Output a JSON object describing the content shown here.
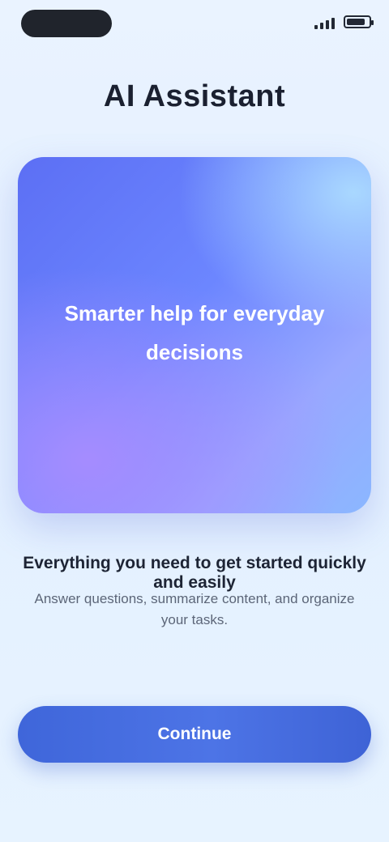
{
  "status_bar": {
    "left_pill": "",
    "icons": [
      "signal-icon",
      "battery-icon"
    ]
  },
  "title": "AI Assistant",
  "hero": {
    "line1": "Smarter help for everyday",
    "line2": "decisions"
  },
  "copy": {
    "headline": "Everything you need to get started quickly and easily",
    "sub_line1": "Answer questions, summarize content, and organize",
    "sub_line2": "your tasks."
  },
  "cta": {
    "label": "Continue"
  },
  "colors": {
    "accent": "#4d74e6",
    "hero_start": "#5c6ff4",
    "hero_end": "#8bb7ff"
  }
}
